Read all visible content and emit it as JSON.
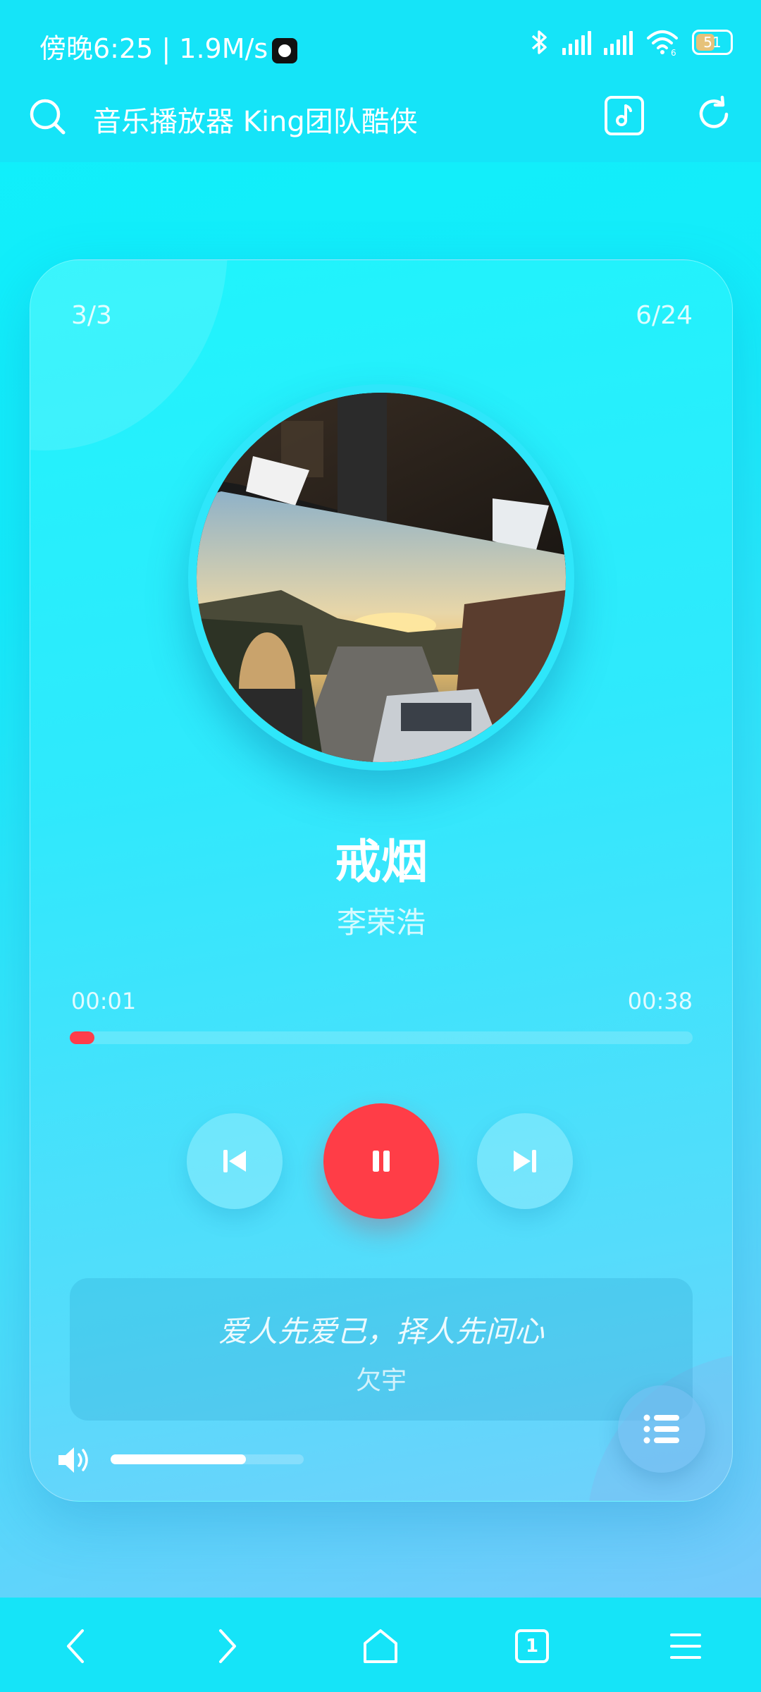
{
  "status_bar": {
    "time_speed": "傍晚6:25 | 1.9M/s",
    "wifi_badge": "6",
    "battery": "51"
  },
  "header": {
    "title": "音乐播放器 King团队酷侠",
    "icons": [
      "search-icon",
      "music-note-icon",
      "refresh-icon"
    ]
  },
  "player": {
    "playlist_position": "3/3",
    "track_count": "6/24",
    "song_title": "戒烟",
    "artist": "李荣浩",
    "current_time": "00:01",
    "total_time": "00:38",
    "progress": 0.04,
    "state": "playing",
    "controls": [
      "skip-previous-icon",
      "pause-icon",
      "skip-next-icon"
    ],
    "quote": {
      "text": "爱人先爱己，择人先问心",
      "author": "欠宇"
    },
    "volume": 0.7,
    "accent_color": "#ff3d47"
  },
  "bottom_nav": {
    "items": [
      "back-icon",
      "forward-icon",
      "home-icon",
      "tabs-icon",
      "menu-icon"
    ],
    "tabs_count": "1"
  }
}
